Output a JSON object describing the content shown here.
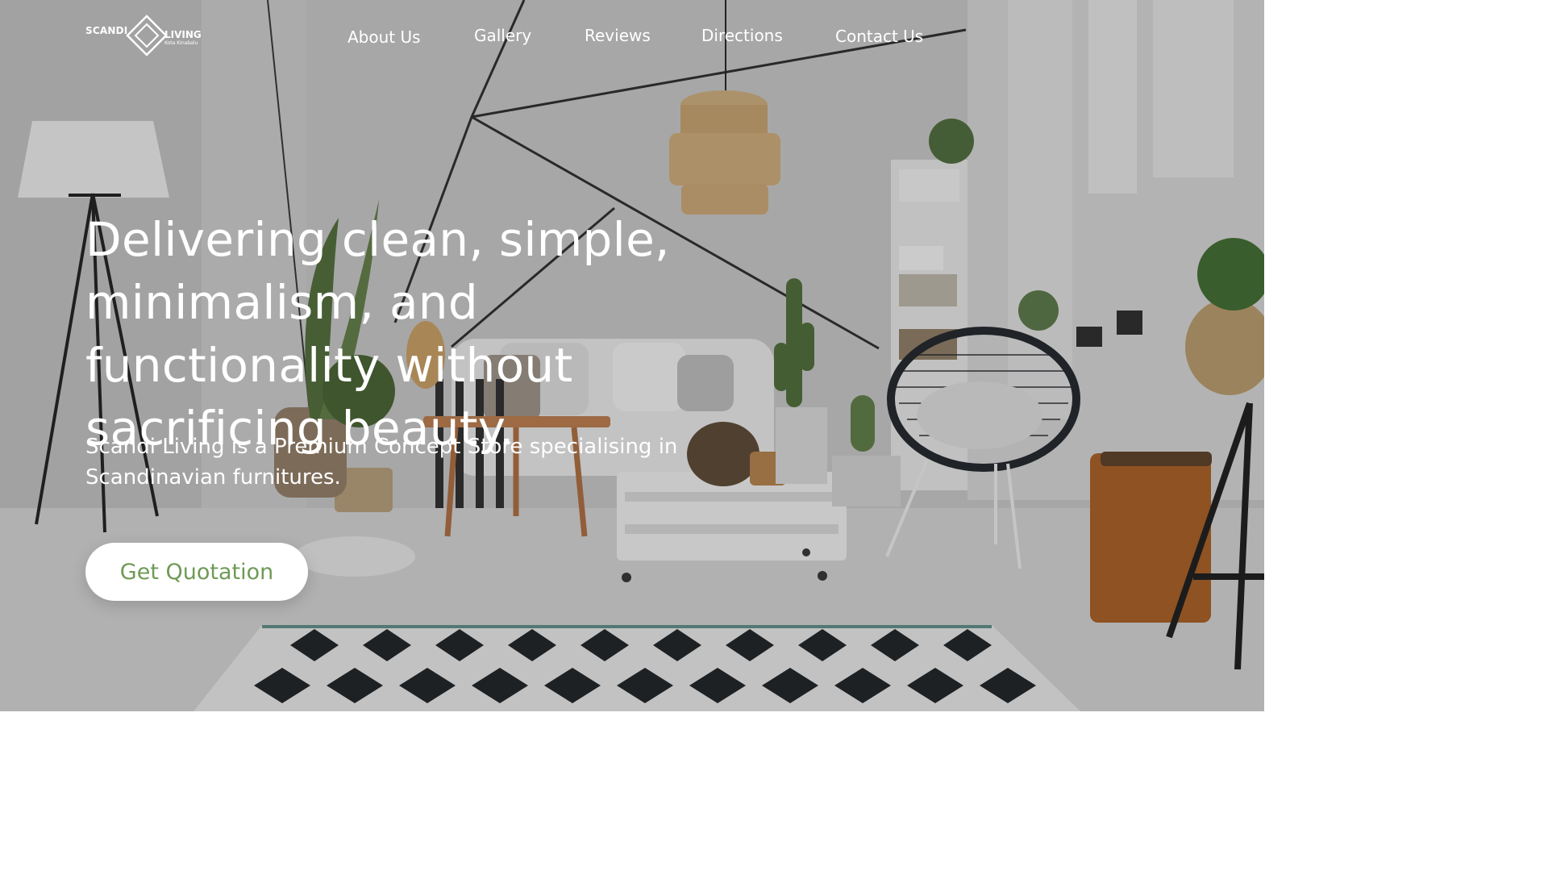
{
  "brand": {
    "name_left": "SCANDI",
    "name_right": "LIVING",
    "location": "Kota Kinabalu"
  },
  "nav": {
    "items": [
      {
        "label": "About Us"
      },
      {
        "label": "Gallery"
      },
      {
        "label": "Reviews"
      },
      {
        "label": "Directions"
      },
      {
        "label": "Contact Us"
      }
    ]
  },
  "hero": {
    "headline": "Delivering clean, simple, minimalism, and functionality without sacrificing beauty.",
    "subtext": "Scandi Living is a Premium Concept Store specialising in Scandinavian furnitures.",
    "cta_label": "Get Quotation",
    "cta_text_color": "#6f9a55"
  },
  "background": {
    "description_icon": "living-room-photo"
  }
}
